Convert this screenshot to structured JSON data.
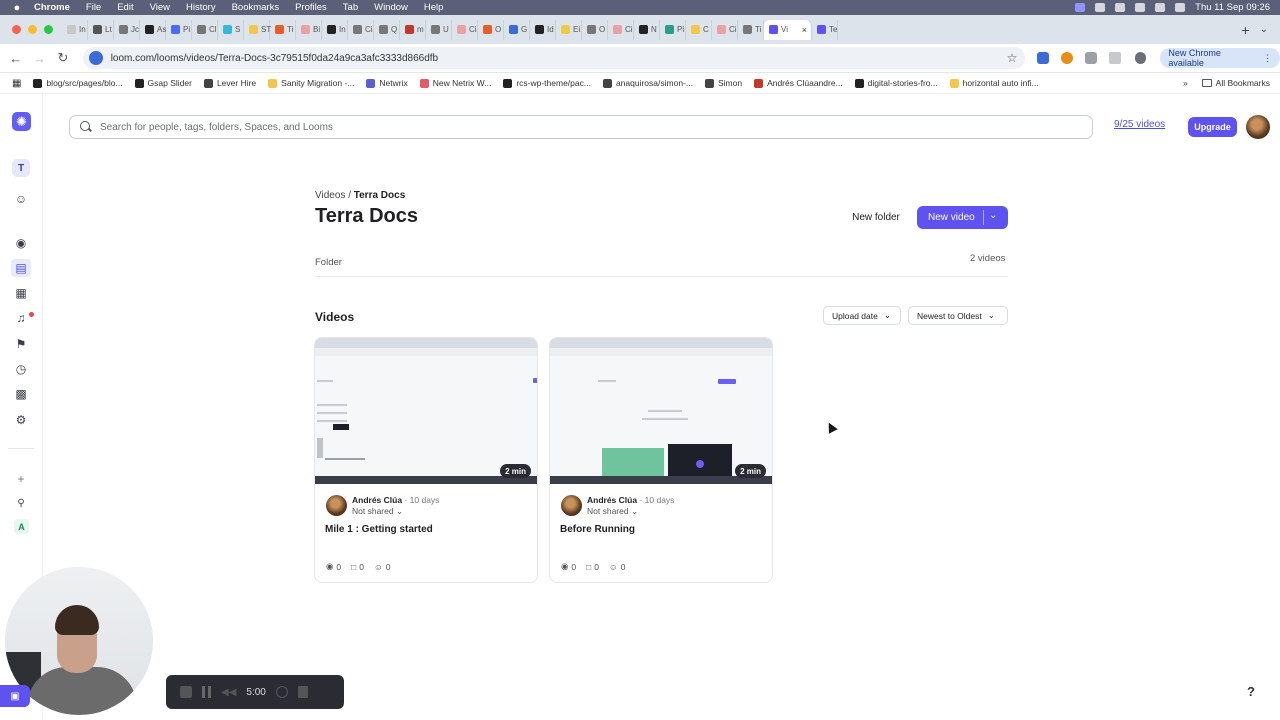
{
  "menubar": {
    "app": "Chrome",
    "items": [
      "File",
      "Edit",
      "View",
      "History",
      "Bookmarks",
      "Profiles",
      "Tab",
      "Window",
      "Help"
    ],
    "clock": "Thu 11 Sep  09:26"
  },
  "tabs": [
    {
      "label": "In",
      "color": "#c8c8c8"
    },
    {
      "label": "Lt",
      "color": "#555555"
    },
    {
      "label": "Jc",
      "color": "#777777"
    },
    {
      "label": "As",
      "color": "#222222"
    },
    {
      "label": "Pi",
      "color": "#4a6cf7"
    },
    {
      "label": "Cl",
      "color": "#777777"
    },
    {
      "label": "S",
      "color": "#39b7d9"
    },
    {
      "label": "ST",
      "color": "#f2c84b"
    },
    {
      "label": "Ti",
      "color": "#e45d2b"
    },
    {
      "label": "Bi",
      "color": "#e7a3a3"
    },
    {
      "label": "In",
      "color": "#222222"
    },
    {
      "label": "Ci",
      "color": "#777777"
    },
    {
      "label": "Q",
      "color": "#777777"
    },
    {
      "label": "m",
      "color": "#c0392b"
    },
    {
      "label": "U",
      "color": "#777777"
    },
    {
      "label": "Ci",
      "color": "#e7a3a3"
    },
    {
      "label": "O",
      "color": "#e45d2b"
    },
    {
      "label": "G",
      "color": "#3b6bd6"
    },
    {
      "label": "Id",
      "color": "#222222"
    },
    {
      "label": "Ei",
      "color": "#f2c84b"
    },
    {
      "label": "O",
      "color": "#777777"
    },
    {
      "label": "Ci",
      "color": "#e7a3a3"
    },
    {
      "label": "N",
      "color": "#222222"
    },
    {
      "label": "Pi",
      "color": "#2a9d8f"
    },
    {
      "label": "C",
      "color": "#f2c84b"
    },
    {
      "label": "Ci",
      "color": "#e7a3a3"
    },
    {
      "label": "Ti",
      "color": "#777777"
    },
    {
      "label": "Vi",
      "color": "#5e52f0",
      "active": true
    },
    {
      "label": "Te",
      "color": "#5e52f0"
    }
  ],
  "address": {
    "url": "loom.com/looms/videos/Terra-Docs-3c79515f0da24a9ca3afc3333d866dfb",
    "update_label": "New Chrome available"
  },
  "bookmarks": [
    {
      "label": "blog/src/pages/blo...",
      "color": "#222222"
    },
    {
      "label": "Gsap Slider",
      "color": "#222222"
    },
    {
      "label": "Lever Hire",
      "color": "#444444"
    },
    {
      "label": "Sanity Migration -...",
      "color": "#f2c84b"
    },
    {
      "label": "Netwrix",
      "color": "#5a5fd6"
    },
    {
      "label": "New Netrix W...",
      "color": "#e35b6b"
    },
    {
      "label": "rcs-wp-theme/pac...",
      "color": "#222222"
    },
    {
      "label": "anaquirosa/simon-...",
      "color": "#444444"
    },
    {
      "label": "Simon",
      "color": "#444444"
    },
    {
      "label": "Andrés Clúaandre...",
      "color": "#c0392b"
    },
    {
      "label": "digital-stories-fro...",
      "color": "#222222"
    },
    {
      "label": "horizontal auto infi...",
      "color": "#f2c84b"
    }
  ],
  "bookmarks_all": "All Bookmarks",
  "rail": {
    "workspace_initial": "T",
    "workspace2_initial": "A"
  },
  "search": {
    "placeholder": "Search for people, tags, folders, Spaces, and Looms"
  },
  "quota": "9/25 videos",
  "upgrade_label": "Upgrade",
  "breadcrumb": {
    "parent": "Videos",
    "separator": "/",
    "current": "Terra Docs"
  },
  "page_title": "Terra Docs",
  "new_folder_label": "New folder",
  "new_video_label": "New video",
  "folder_label": "Folder",
  "folder_count": "2 videos",
  "videos_heading": "Videos",
  "sort": {
    "field": "Upload date",
    "order": "Newest to Oldest"
  },
  "videos": [
    {
      "title": "Mile 1 : Getting started",
      "author": "Andrés Clúa",
      "ago": "10 days",
      "sharing": "Not shared",
      "duration": "2 min",
      "views": "0",
      "comments": "0",
      "reactions": "0"
    },
    {
      "title": "Before Running",
      "author": "Andrés Clúa",
      "ago": "10 days",
      "sharing": "Not shared",
      "duration": "2 min",
      "views": "0",
      "comments": "0",
      "reactions": "0"
    }
  ],
  "recorder": {
    "time": "5:00"
  },
  "help_label": "?"
}
